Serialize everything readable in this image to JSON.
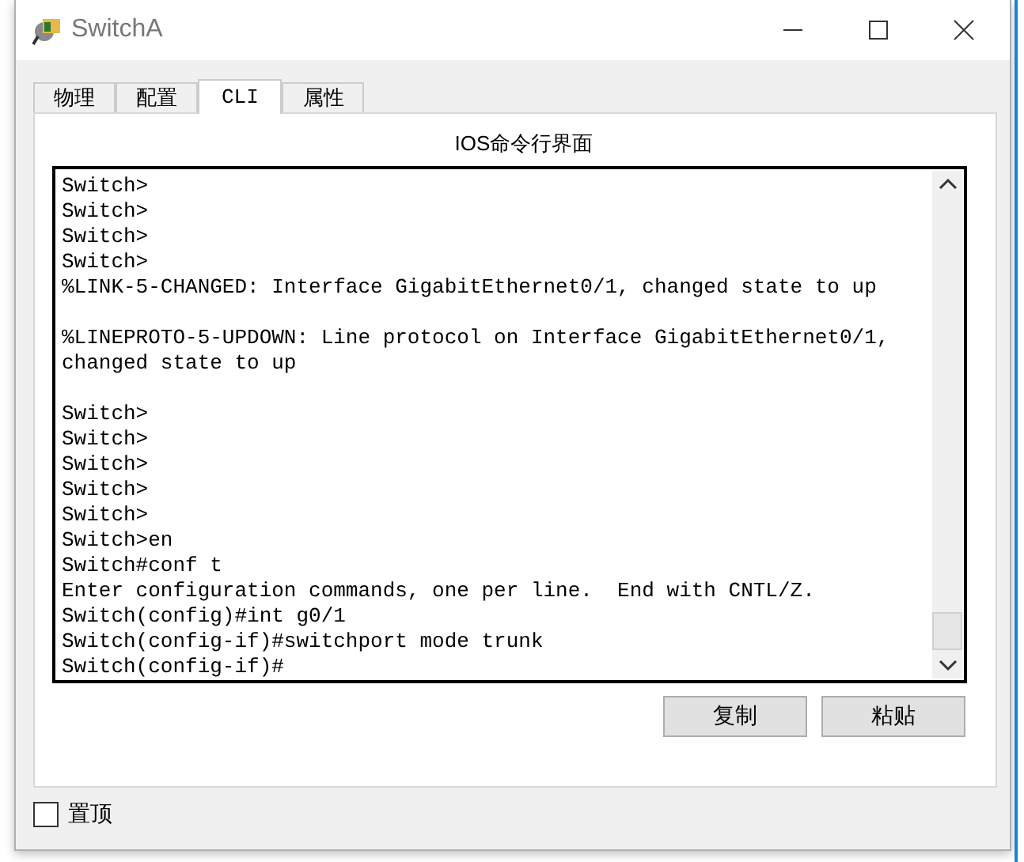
{
  "window": {
    "title": "SwitchA"
  },
  "tabs": [
    {
      "label": "物理",
      "selected": false
    },
    {
      "label": "配置",
      "selected": false
    },
    {
      "label": "CLI",
      "selected": true
    },
    {
      "label": "属性",
      "selected": false
    }
  ],
  "panel_title": "IOS命令行界面",
  "terminal": {
    "lines": [
      {
        "kind": "text",
        "text": "Switch>"
      },
      {
        "kind": "text",
        "text": "Switch>"
      },
      {
        "kind": "text",
        "text": "Switch>"
      },
      {
        "kind": "text",
        "text": "Switch>"
      },
      {
        "kind": "text",
        "text": "%LINK-5-CHANGED: Interface GigabitEthernet0/1, changed state to up"
      },
      {
        "kind": "blank"
      },
      {
        "kind": "text",
        "text": "%LINEPROTO-5-UPDOWN: Line protocol on Interface GigabitEthernet0/1,"
      },
      {
        "kind": "text",
        "text": "changed state to up"
      },
      {
        "kind": "blank"
      },
      {
        "kind": "text",
        "text": "Switch>"
      },
      {
        "kind": "text",
        "text": "Switch>"
      },
      {
        "kind": "text",
        "text": "Switch>"
      },
      {
        "kind": "text",
        "text": "Switch>"
      },
      {
        "kind": "text",
        "text": "Switch>"
      },
      {
        "kind": "text",
        "text": "Switch>en"
      },
      {
        "kind": "text",
        "text": "Switch#conf t"
      },
      {
        "kind": "text",
        "text": "Enter configuration commands, one per line.  End with CNTL/Z."
      },
      {
        "kind": "text",
        "text": "Switch(config)#int g0/1"
      },
      {
        "kind": "text",
        "text": "Switch(config-if)#switchport mode trunk"
      },
      {
        "kind": "text",
        "text": "Switch(config-if)#"
      }
    ]
  },
  "buttons": [
    "复制",
    "粘贴"
  ],
  "always_on_top": {
    "label": "置顶",
    "checked": false
  }
}
